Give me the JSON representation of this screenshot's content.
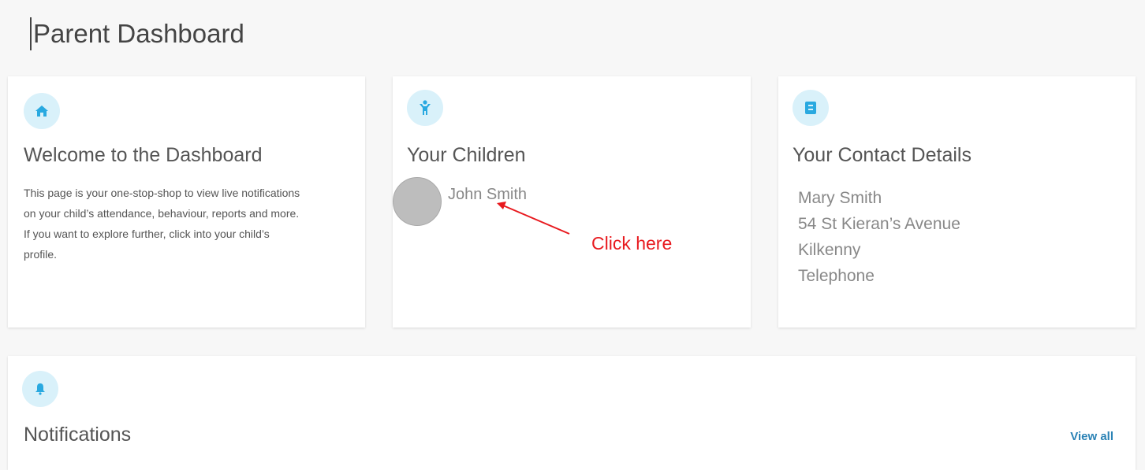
{
  "page": {
    "title": "Parent Dashboard"
  },
  "welcome_card": {
    "icon": "home-icon",
    "title": "Welcome to the Dashboard",
    "body_lines": [
      "This page is your one-stop-shop to view live notifications",
      "on your child’s attendance, behaviour, reports and more.",
      "If you want to explore further, click into your child’s",
      "profile."
    ]
  },
  "children_card": {
    "icon": "child-icon",
    "title": "Your Children",
    "children": [
      {
        "name": "John Smith"
      }
    ]
  },
  "contact_card": {
    "icon": "contact-book-icon",
    "title": "Your Contact Details",
    "lines": [
      "Mary Smith",
      "54 St Kieran’s Avenue",
      "Kilkenny",
      "Telephone"
    ]
  },
  "notifications_card": {
    "icon": "bell-icon",
    "title": "Notifications",
    "view_all_label": "View all"
  },
  "annotation": {
    "text": "Click here",
    "color": "#e8191e"
  },
  "colors": {
    "accent": "#2a82b5",
    "icon_bg": "#d9f1fa",
    "icon_fg": "#29a9e0"
  }
}
